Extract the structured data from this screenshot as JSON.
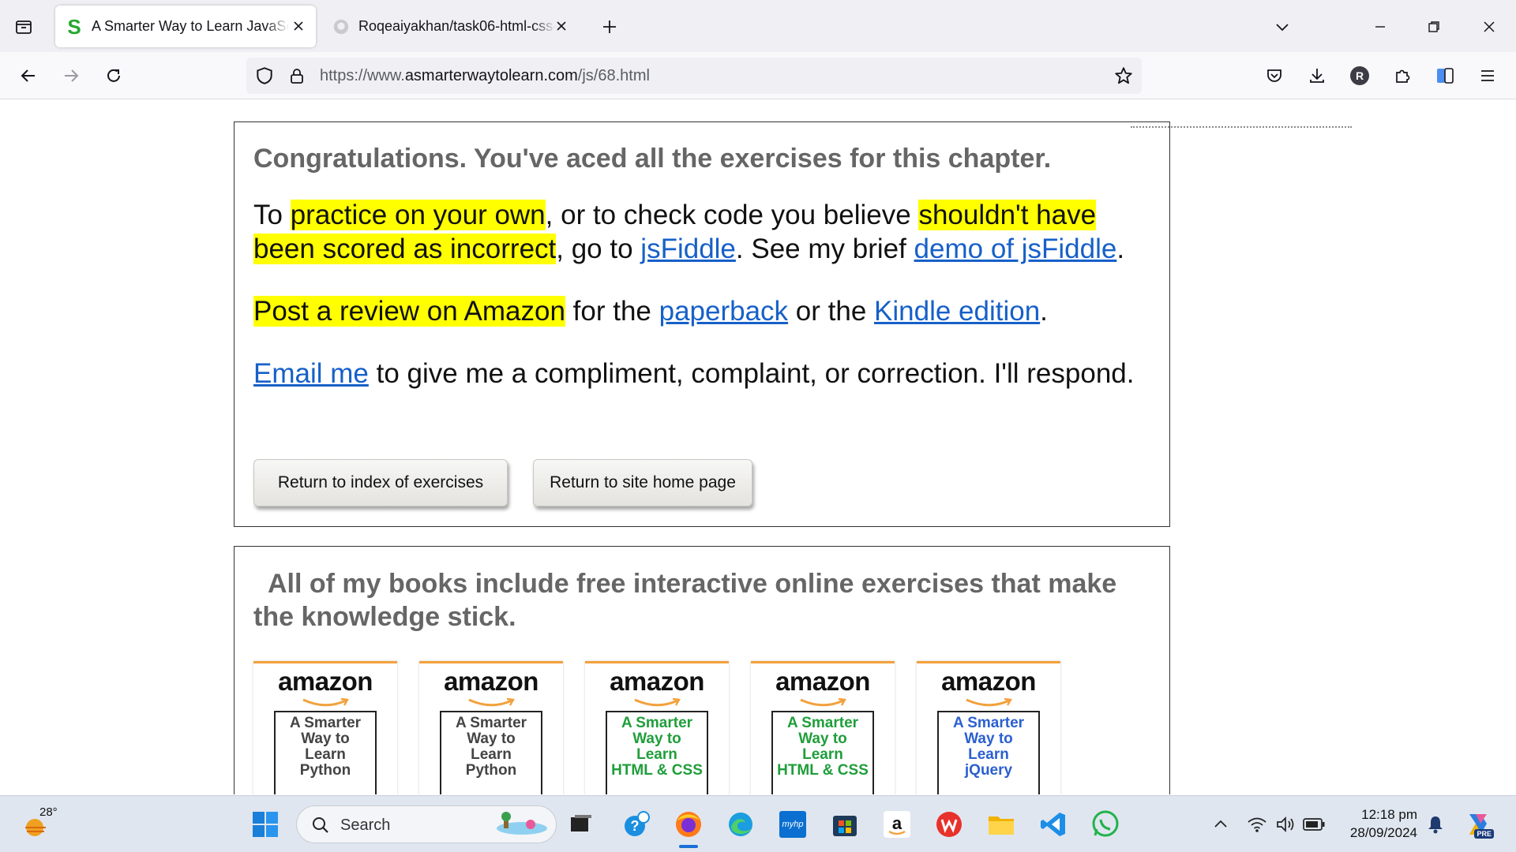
{
  "browser": {
    "tabs": [
      {
        "title": "A Smarter Way to Learn JavaScr",
        "active": true
      },
      {
        "title": "Roqeaiyakhan/task06-html-css-",
        "active": false
      }
    ],
    "url": {
      "prefix": "https://www.",
      "domain": "asmarterwaytolearn.com",
      "path": "/js/68.html"
    },
    "profile_initial": "R"
  },
  "page": {
    "congrats_heading": "Congratulations. You've aced all the exercises for this chapter.",
    "p1": {
      "t1": "To ",
      "h1": "practice on your own",
      "t2": ", or to check code you believe ",
      "h2": "shouldn't have been scored as incorrect",
      "t3": ", go to ",
      "link1": "jsFiddle",
      "t4": ". See my brief ",
      "link2": "demo of jsFiddle",
      "t5": "."
    },
    "p2": {
      "h1": "Post a review on Amazon",
      "t1": " for the ",
      "link1": "paperback",
      "t2": " or the ",
      "link2": "Kindle edition",
      "t3": "."
    },
    "p3": {
      "link1": "Email me",
      "t1": " to give me a compliment, complaint, or correction. I'll respond."
    },
    "buttons": {
      "index": "Return to index of exercises",
      "home": "Return to site home page"
    },
    "books_heading": "All of my books include free interactive online exercises that make the knowledge stick.",
    "books": [
      {
        "brand": "amazon",
        "title": [
          "A Smarter",
          "Way to",
          "Learn",
          "Python"
        ],
        "color": "#444444"
      },
      {
        "brand": "amazon",
        "title": [
          "A Smarter",
          "Way to",
          "Learn",
          "Python"
        ],
        "color": "#444444"
      },
      {
        "brand": "amazon",
        "title": [
          "A Smarter",
          "Way to",
          "Learn",
          "HTML & CSS"
        ],
        "color": "#1f9e3a"
      },
      {
        "brand": "amazon",
        "title": [
          "A Smarter",
          "Way to",
          "Learn",
          "HTML & CSS"
        ],
        "color": "#1f9e3a"
      },
      {
        "brand": "amazon",
        "title": [
          "A Smarter",
          "Way to",
          "Learn",
          "jQuery"
        ],
        "color": "#2b5fd0"
      }
    ]
  },
  "taskbar": {
    "temperature": "28°",
    "search_label": "Search",
    "time": "12:18 pm",
    "date": "28/09/2024",
    "hp_label": "myhp",
    "copilot_badge": "PRE"
  },
  "colors": {
    "highlight": "#ffff00",
    "link": "#1660c8",
    "heading": "#666666"
  }
}
